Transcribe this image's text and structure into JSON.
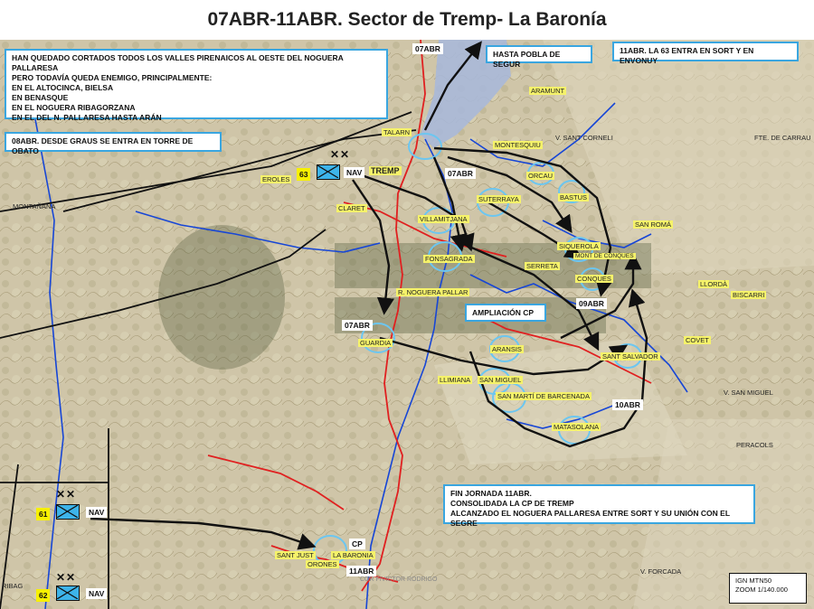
{
  "title": "07ABR-11ABR. Sector de Tremp- La Baronía",
  "map_source": "IGN MTN50",
  "zoom": "ZOOM 1/140.000",
  "credit": "COR FIVICTOR RODRIGO",
  "boxes": {
    "intro_lines": [
      "HAN QUEDADO CORTADOS TODOS LOS VALLES PIRENAICOS AL OESTE DEL NOGUERA PALLARESA",
      "PERO TODAVÍA QUEDA ENEMIGO, PRINCIPALMENTE:",
      "EN EL ALTOCINCA, BIELSA",
      "EN BENASQUE",
      "EN EL NOGUERA RIBAGORZANA",
      "EN EL DEL N. PALLARESA HASTA ARÁN"
    ],
    "graus": "08ABR. DESDE GRAUS SE ENTRA EN TORRE DE OBATO",
    "pobla": "HASTA POBLA DE SEGUR",
    "sort": "11ABR. LA 63 ENTRA EN SORT Y EN ENVONUY",
    "ampliacion": "AMPLIACIÓN CP",
    "fin_lines": [
      "FIN JORNADA 11ABR.",
      "CONSOLIDADA LA CP DE TREMP",
      "ALCANZADO EL NOGUERA PALLARESA ENTRE SORT Y SU UNIÓN CON EL SEGRE"
    ]
  },
  "arrow_labels": {
    "top": "07ABR",
    "mid": "07ABR",
    "left": "07ABR",
    "a09": "09ABR",
    "a10": "10ABR",
    "cp": "CP",
    "cp_date": "11ABR"
  },
  "units": {
    "u63": {
      "number": "63",
      "type": "NAV"
    },
    "u61": {
      "number": "61",
      "type": "NAV"
    },
    "u62": {
      "number": "62",
      "type": "NAV"
    }
  },
  "places": {
    "talarn": "TALARN",
    "tremp": "TREMP",
    "eroles": "EROLES",
    "claret": "CLARET",
    "montanana": "MONTAÑANA",
    "aramunt": "ARAMUNT",
    "montesquiu": "MONTESQUIU",
    "sant_corneli": "V. SANT CORNELI",
    "carrau": "FTE. DE CARRAU",
    "orcau": "ORCAU",
    "suterraya": "SUTERRAYA",
    "bastus": "BASTUS",
    "san_roma": "SAN ROMÁ",
    "vilamitjana": "VILLAMITJANA",
    "fonsagrada": "FONSAGRADA",
    "siquerola": "SIQUEROLA",
    "conques_sub": "MONT DE CONQUES",
    "serreta": "SERRETA",
    "conques": "CONQUES",
    "llorda": "LLORDÀ",
    "biscarri": "BISCARRI",
    "noguera": "R. NOGUERA PALLAR",
    "guardia": "GUARDIA",
    "covet": "COVET",
    "aransis": "ARANSIS",
    "sant_salvador": "SANT SALVADOR",
    "llimiana": "LLIMIANA",
    "san_miguel": "SAN MIGUEL",
    "v_san_miguel": "V. SAN MIGUEL",
    "san_marti": "SAN MARTÍ DE BARCENADA",
    "matasolana": "MATASOLANA",
    "sant_just": "SANT JUST",
    "la_baronia": "LA BARONIA",
    "orones": "ORONES",
    "ribag": "RIBAG",
    "peracols": "PERACOLS",
    "forcada": "V. FORCADA"
  },
  "colors": {
    "frame": "#3aa6e0",
    "unit_fill": "#3db4ea",
    "unit_num_bg": "#f7f000",
    "river": "#1746d6",
    "road": "#e02020",
    "arrow": "#111111",
    "highlight": "#6cc6f0"
  }
}
